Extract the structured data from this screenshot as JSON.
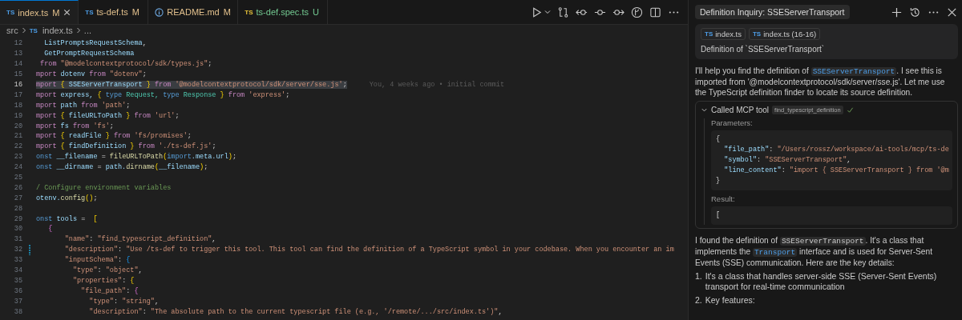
{
  "editor_tabs": [
    {
      "kind": "typescript",
      "badge": "TS",
      "label": "index.ts",
      "modified": true,
      "status": "M",
      "selected": true
    },
    {
      "kind": "typescript",
      "badge": "TS",
      "label": "ts-def.ts",
      "modified": true,
      "status": "M",
      "selected": false
    },
    {
      "kind": "info",
      "label": "README.md",
      "modified": true,
      "status": "M",
      "selected": false
    },
    {
      "kind": "test",
      "badge": "TS",
      "label": "ts-def.spec.ts",
      "modified": false,
      "status": "U",
      "selected": false
    }
  ],
  "breadcrumb": [
    {
      "label": "src"
    },
    {
      "badge": "TS",
      "label": "index.ts"
    },
    {
      "label": "..."
    }
  ],
  "editor": {
    "lines": [
      {
        "number": "12",
        "current": false,
        "modified": false,
        "tokens": [
          {
            "text": "  ListPromptsRequestSchema",
            "kind": "var"
          },
          {
            "text": ",",
            "kind": "plain"
          }
        ]
      },
      {
        "number": "13",
        "current": false,
        "modified": false,
        "tokens": [
          {
            "text": "  GetPromptRequestSchema",
            "kind": "var"
          }
        ]
      },
      {
        "number": "14",
        "current": false,
        "modified": false,
        "tokens": [
          {
            "text": " from ",
            "kind": "ctl"
          },
          {
            "text": "\"@modelcontextprotocol/sdk/types.js\"",
            "kind": "str"
          },
          {
            "text": ";",
            "kind": "plain"
          }
        ]
      },
      {
        "number": "15",
        "current": false,
        "modified": false,
        "tokens": [
          {
            "text": "mport",
            "kind": "ctl"
          },
          {
            "text": " dotenv ",
            "kind": "var"
          },
          {
            "text": "from",
            "kind": "ctl"
          },
          {
            "text": " \"dotenv\"",
            "kind": "str"
          },
          {
            "text": ";",
            "kind": "plain"
          }
        ]
      },
      {
        "number": "16",
        "current": true,
        "modified": false,
        "blame": "You, 4 weeks ago • initial commit",
        "tokens": [
          {
            "text": "mport",
            "kind": "ctl"
          },
          {
            "text": " { ",
            "kind": "brace"
          },
          {
            "text": "SSEServerTransport",
            "kind": "var"
          },
          {
            "text": " } ",
            "kind": "brace"
          },
          {
            "text": "from",
            "kind": "ctl"
          },
          {
            "text": " '@modelcontextprotocol/sdk/server/sse.js'",
            "kind": "str"
          },
          {
            "text": ";",
            "kind": "plain"
          }
        ]
      },
      {
        "number": "17",
        "current": false,
        "modified": false,
        "tokens": [
          {
            "text": "mport",
            "kind": "ctl"
          },
          {
            "text": " express, ",
            "kind": "var"
          },
          {
            "text": "{ ",
            "kind": "brace"
          },
          {
            "text": "type",
            "kind": "kw"
          },
          {
            "text": " Request, ",
            "kind": "type"
          },
          {
            "text": "type",
            "kind": "kw"
          },
          {
            "text": " Response ",
            "kind": "type"
          },
          {
            "text": "} ",
            "kind": "brace"
          },
          {
            "text": "from",
            "kind": "ctl"
          },
          {
            "text": " 'express'",
            "kind": "str"
          },
          {
            "text": ";",
            "kind": "plain"
          }
        ]
      },
      {
        "number": "18",
        "current": false,
        "modified": false,
        "tokens": [
          {
            "text": "mport",
            "kind": "ctl"
          },
          {
            "text": " path ",
            "kind": "var"
          },
          {
            "text": "from",
            "kind": "ctl"
          },
          {
            "text": " 'path'",
            "kind": "str"
          },
          {
            "text": ";",
            "kind": "plain"
          }
        ]
      },
      {
        "number": "19",
        "current": false,
        "modified": false,
        "tokens": [
          {
            "text": "mport",
            "kind": "ctl"
          },
          {
            "text": " { ",
            "kind": "brace"
          },
          {
            "text": "fileURLToPath",
            "kind": "var"
          },
          {
            "text": " } ",
            "kind": "brace"
          },
          {
            "text": "from",
            "kind": "ctl"
          },
          {
            "text": " 'url'",
            "kind": "str"
          },
          {
            "text": ";",
            "kind": "plain"
          }
        ]
      },
      {
        "number": "20",
        "current": false,
        "modified": false,
        "tokens": [
          {
            "text": "mport",
            "kind": "ctl"
          },
          {
            "text": " fs ",
            "kind": "var"
          },
          {
            "text": "from",
            "kind": "ctl"
          },
          {
            "text": " 'fs'",
            "kind": "str"
          },
          {
            "text": ";",
            "kind": "plain"
          }
        ]
      },
      {
        "number": "21",
        "current": false,
        "modified": false,
        "tokens": [
          {
            "text": "mport",
            "kind": "ctl"
          },
          {
            "text": " { ",
            "kind": "brace"
          },
          {
            "text": "readFile",
            "kind": "var"
          },
          {
            "text": " } ",
            "kind": "brace"
          },
          {
            "text": "from",
            "kind": "ctl"
          },
          {
            "text": " 'fs/promises'",
            "kind": "str"
          },
          {
            "text": ";",
            "kind": "plain"
          }
        ]
      },
      {
        "number": "22",
        "current": false,
        "modified": false,
        "tokens": [
          {
            "text": "mport",
            "kind": "ctl"
          },
          {
            "text": " { ",
            "kind": "brace"
          },
          {
            "text": "findDefinition",
            "kind": "var"
          },
          {
            "text": " } ",
            "kind": "brace"
          },
          {
            "text": "from",
            "kind": "ctl"
          },
          {
            "text": " './ts-def.js'",
            "kind": "str"
          },
          {
            "text": ";",
            "kind": "plain"
          }
        ]
      },
      {
        "number": "23",
        "current": false,
        "modified": false,
        "tokens": [
          {
            "text": "onst",
            "kind": "kw"
          },
          {
            "text": " __filename ",
            "kind": "var"
          },
          {
            "text": "= ",
            "kind": "plain"
          },
          {
            "text": "fileURLToPath",
            "kind": "fn"
          },
          {
            "text": "(",
            "kind": "brace"
          },
          {
            "text": "import",
            "kind": "kw"
          },
          {
            "text": ".meta.url",
            "kind": "var"
          },
          {
            "text": ")",
            "kind": "brace"
          },
          {
            "text": ";",
            "kind": "plain"
          }
        ]
      },
      {
        "number": "24",
        "current": false,
        "modified": false,
        "tokens": [
          {
            "text": "onst",
            "kind": "kw"
          },
          {
            "text": " __dirname ",
            "kind": "var"
          },
          {
            "text": "= ",
            "kind": "plain"
          },
          {
            "text": "path.",
            "kind": "var"
          },
          {
            "text": "dirname",
            "kind": "fn"
          },
          {
            "text": "(",
            "kind": "brace"
          },
          {
            "text": "__filename",
            "kind": "var"
          },
          {
            "text": ")",
            "kind": "brace"
          },
          {
            "text": ";",
            "kind": "plain"
          }
        ]
      },
      {
        "number": "25",
        "current": false,
        "modified": false
      },
      {
        "number": "26",
        "current": false,
        "modified": false,
        "tokens": [
          {
            "text": "/ Configure environment variables",
            "kind": "cmt"
          }
        ]
      },
      {
        "number": "27",
        "current": false,
        "modified": false,
        "tokens": [
          {
            "text": "otenv.",
            "kind": "var"
          },
          {
            "text": "config",
            "kind": "fn"
          },
          {
            "text": "()",
            "kind": "brace"
          },
          {
            "text": ";",
            "kind": "plain"
          }
        ]
      },
      {
        "number": "28",
        "current": false,
        "modified": false
      },
      {
        "number": "29",
        "current": false,
        "modified": false,
        "tokens": [
          {
            "text": "onst",
            "kind": "kw"
          },
          {
            "text": " tools ",
            "kind": "var"
          },
          {
            "text": "=  ",
            "kind": "plain"
          },
          {
            "text": "[",
            "kind": "brace"
          }
        ]
      },
      {
        "number": "30",
        "current": false,
        "modified": false,
        "tokens": [
          {
            "text": "   {",
            "kind": "brace2"
          }
        ]
      },
      {
        "number": "31",
        "current": false,
        "modified": false,
        "tokens": [
          {
            "text": "       \"name\"",
            "kind": "str"
          },
          {
            "text": ": ",
            "kind": "plain"
          },
          {
            "text": "\"find_typescript_definition\"",
            "kind": "str"
          },
          {
            "text": ",",
            "kind": "plain"
          }
        ]
      },
      {
        "number": "32",
        "current": false,
        "modified": true,
        "tokens": [
          {
            "text": "       \"description\"",
            "kind": "str"
          },
          {
            "text": ": ",
            "kind": "plain"
          },
          {
            "text": "\"Use /ts-def to trigger this tool. This tool can find the definition of a TypeScript symbol in your codebase. When you encounter an im",
            "kind": "str"
          }
        ]
      },
      {
        "number": "33",
        "current": false,
        "modified": false,
        "tokens": [
          {
            "text": "       \"inputSchema\"",
            "kind": "str"
          },
          {
            "text": ": ",
            "kind": "plain"
          },
          {
            "text": "{",
            "kind": "brace3"
          }
        ]
      },
      {
        "number": "34",
        "current": false,
        "modified": false,
        "tokens": [
          {
            "text": "         \"type\"",
            "kind": "str"
          },
          {
            "text": ": ",
            "kind": "plain"
          },
          {
            "text": "\"object\"",
            "kind": "str"
          },
          {
            "text": ",",
            "kind": "plain"
          }
        ]
      },
      {
        "number": "35",
        "current": false,
        "modified": false,
        "tokens": [
          {
            "text": "         \"properties\"",
            "kind": "str"
          },
          {
            "text": ": ",
            "kind": "plain"
          },
          {
            "text": "{",
            "kind": "brace"
          }
        ]
      },
      {
        "number": "36",
        "current": false,
        "modified": false,
        "tokens": [
          {
            "text": "           \"file_path\"",
            "kind": "str"
          },
          {
            "text": ": ",
            "kind": "plain"
          },
          {
            "text": "{",
            "kind": "brace2"
          }
        ]
      },
      {
        "number": "37",
        "current": false,
        "modified": false,
        "tokens": [
          {
            "text": "             \"type\"",
            "kind": "str"
          },
          {
            "text": ": ",
            "kind": "plain"
          },
          {
            "text": "\"string\"",
            "kind": "str"
          },
          {
            "text": ",",
            "kind": "plain"
          }
        ]
      },
      {
        "number": "38",
        "current": false,
        "modified": false,
        "tokens": [
          {
            "text": "             \"description\"",
            "kind": "str"
          },
          {
            "text": ": ",
            "kind": "plain"
          },
          {
            "text": "\"The absolute path to the current typescript file (e.g., '/remote/.../src/index.ts')\"",
            "kind": "str"
          },
          {
            "text": ",",
            "kind": "plain"
          }
        ]
      }
    ]
  },
  "chat": {
    "title": "Definition Inquiry: SSEServerTransport",
    "request": {
      "attachments": [
        {
          "badge": "TS",
          "label": "index.ts"
        },
        {
          "badge": "TS",
          "label": "index.ts (16-16)"
        }
      ],
      "text": "Definition of `SSEServerTransport`"
    },
    "response": [
      {
        "kind": "paragraph",
        "segments": [
          {
            "text": "I'll help you find the definition of ",
            "kind": "text"
          },
          {
            "text": "SSEServerTransport",
            "kind": "symbol"
          },
          {
            "text": ". I see this is imported from '@modelcontextprotocol/sdk/server/sse.js'. Let me use the TypeScript definition finder to locate its source definition.",
            "kind": "text"
          }
        ]
      },
      {
        "kind": "tool_call",
        "label": "Called MCP tool",
        "tool": "find_typescript_definition",
        "expanded": true,
        "done": true,
        "parameters_label": "Parameters:",
        "parameters": [
          [
            {
              "text": "{",
              "kind": "plain"
            }
          ],
          [
            {
              "text": "  \"file_path\"",
              "kind": "key"
            },
            {
              "text": ": ",
              "kind": "plain"
            },
            {
              "text": "\"/Users/rossz/workspace/ai-tools/mcp/ts-de",
              "kind": "str"
            }
          ],
          [
            {
              "text": "  \"symbol\"",
              "kind": "key"
            },
            {
              "text": ": ",
              "kind": "plain"
            },
            {
              "text": "\"SSEServerTransport\"",
              "kind": "str"
            },
            {
              "text": ",",
              "kind": "plain"
            }
          ],
          [
            {
              "text": "  \"line_content\"",
              "kind": "key"
            },
            {
              "text": ": ",
              "kind": "plain"
            },
            {
              "text": "\"import { SSEServerTransport } from '@m",
              "kind": "str"
            }
          ],
          [
            {
              "text": "}",
              "kind": "plain"
            }
          ]
        ],
        "result_label": "Result:",
        "result": [
          [
            {
              "text": "[",
              "kind": "plain"
            }
          ]
        ]
      },
      {
        "kind": "paragraph",
        "segments": [
          {
            "text": "I found the definition of ",
            "kind": "text"
          },
          {
            "text": "SSEServerTransport",
            "kind": "code"
          },
          {
            "text": ". It's a class that implements the ",
            "kind": "text"
          },
          {
            "text": "Transport",
            "kind": "symbol"
          },
          {
            "text": " interface and is used for Server-Sent Events (SSE) communication. Here are the key details:",
            "kind": "text"
          }
        ]
      },
      {
        "kind": "list",
        "items": [
          {
            "marker": "1.",
            "text": "It's a class that handles server-side SSE (Server-Sent Events) transport for real-time communication"
          },
          {
            "marker": "2.",
            "text": "Key features:"
          }
        ]
      }
    ]
  }
}
